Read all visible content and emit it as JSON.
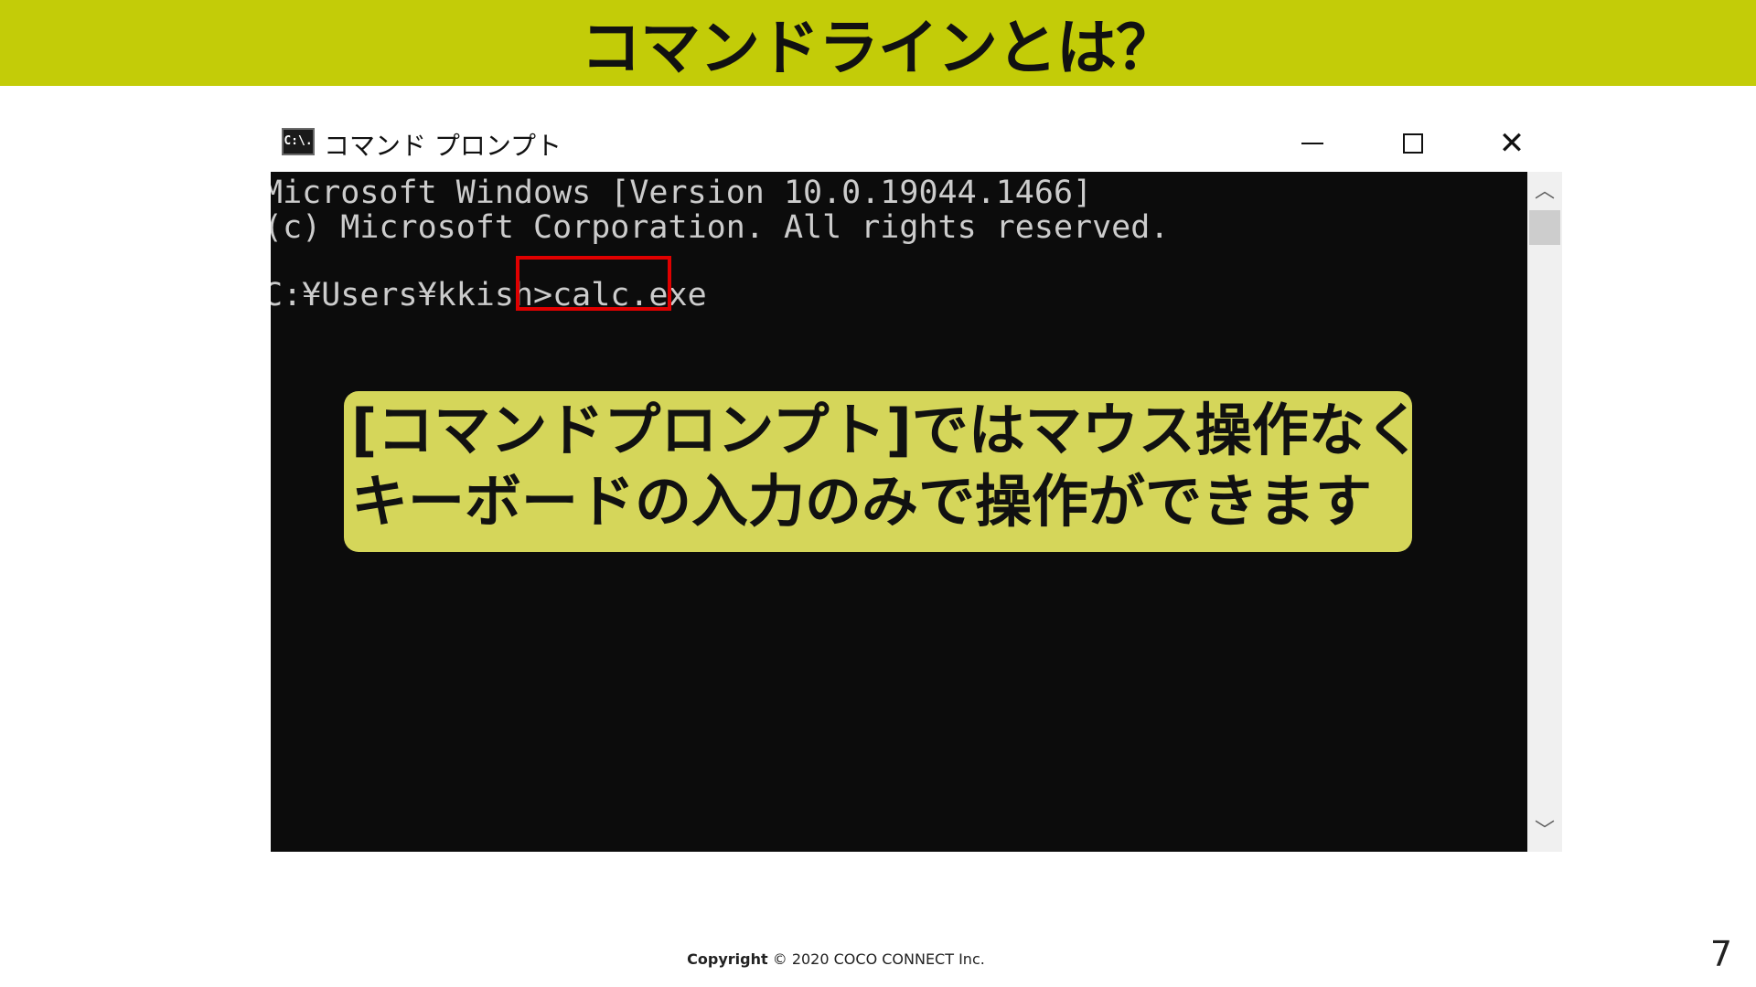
{
  "slide": {
    "title": "コマンドラインとは？",
    "page_number": "7",
    "footer": {
      "label": "Copyright",
      "text": "© 2020 COCO CONNECT Inc."
    }
  },
  "window": {
    "icon_text": "C:\\.",
    "title": "コマンド プロンプト",
    "controls": {
      "minimize": "minimize-icon",
      "maximize": "maximize-icon",
      "close": "close-icon"
    }
  },
  "console": {
    "lines": [
      "Microsoft Windows [Version 10.0.19044.1466]",
      "(c) Microsoft Corporation. All rights reserved.",
      "C:¥Users¥kkish>calc.exe"
    ],
    "highlight_color": "#e00000"
  },
  "callout": {
    "lines": [
      "[コマンドプロンプト]ではマウス操作なく",
      "キーボードの入力のみで操作ができます"
    ],
    "background": "#d5d65a"
  },
  "colors": {
    "title_band": "#c3cc08",
    "console_bg": "#0c0c0c",
    "console_text": "#cccccc"
  }
}
